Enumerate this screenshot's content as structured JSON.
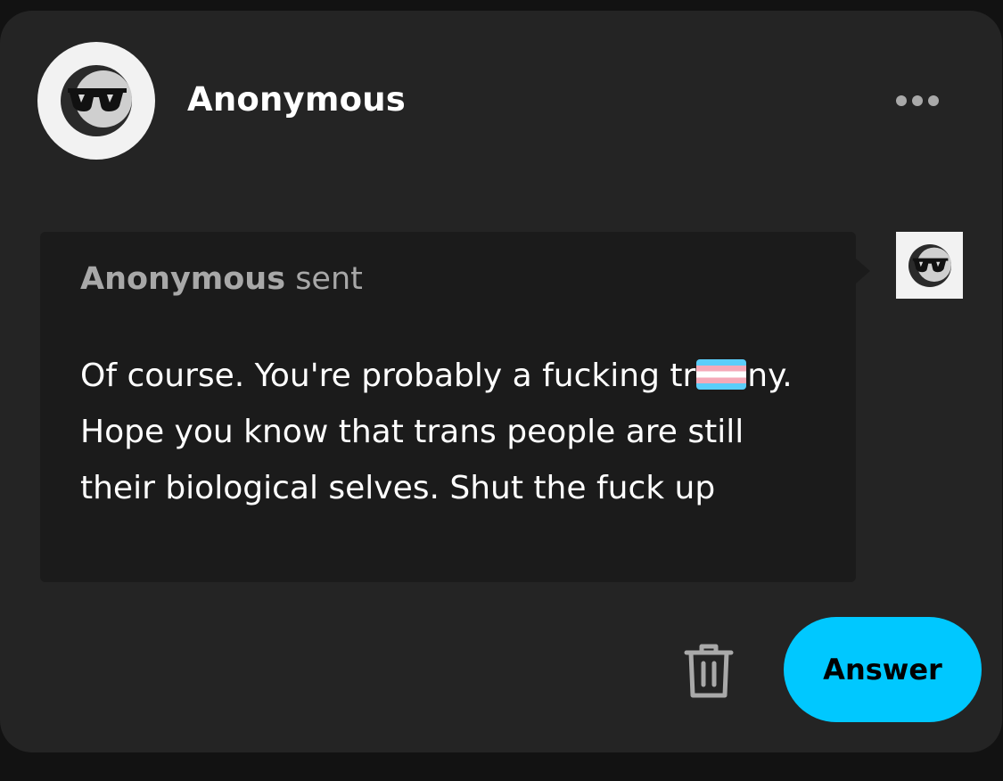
{
  "post": {
    "author": "Anonymous",
    "more_icon": "more-horizontal-icon"
  },
  "ask": {
    "sender_name": "Anonymous",
    "sender_suffix": "sent",
    "message_before_flag": "Of course. You're probably a fucking tr",
    "message_after_flag": "ny. Hope you know that trans people are still their biological selves. Shut the fuck up",
    "flag_icon": "transgender-flag-emoji"
  },
  "actions": {
    "delete_icon": "trash-icon",
    "answer_label": "Answer"
  },
  "colors": {
    "background": "#121212",
    "card": "#242424",
    "bubble": "#1b1b1b",
    "accent": "#00c8ff",
    "muted_text": "#a8a8a8"
  }
}
